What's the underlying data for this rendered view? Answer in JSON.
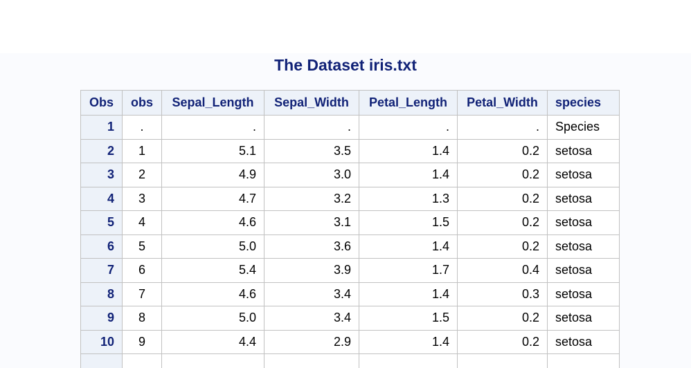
{
  "title": "The Dataset iris.txt",
  "table": {
    "headers": [
      "Obs",
      "obs",
      "Sepal_Length",
      "Sepal_Width",
      "Petal_Length",
      "Petal_Width",
      "species"
    ],
    "rows": [
      [
        "1",
        ".",
        ".",
        ".",
        ".",
        ".",
        "Species"
      ],
      [
        "2",
        "1",
        "5.1",
        "3.5",
        "1.4",
        "0.2",
        "setosa"
      ],
      [
        "3",
        "2",
        "4.9",
        "3.0",
        "1.4",
        "0.2",
        "setosa"
      ],
      [
        "4",
        "3",
        "4.7",
        "3.2",
        "1.3",
        "0.2",
        "setosa"
      ],
      [
        "5",
        "4",
        "4.6",
        "3.1",
        "1.5",
        "0.2",
        "setosa"
      ],
      [
        "6",
        "5",
        "5.0",
        "3.6",
        "1.4",
        "0.2",
        "setosa"
      ],
      [
        "7",
        "6",
        "5.4",
        "3.9",
        "1.7",
        "0.4",
        "setosa"
      ],
      [
        "8",
        "7",
        "4.6",
        "3.4",
        "1.4",
        "0.3",
        "setosa"
      ],
      [
        "9",
        "8",
        "5.0",
        "3.4",
        "1.5",
        "0.2",
        "setosa"
      ],
      [
        "10",
        "9",
        "4.4",
        "2.9",
        "1.4",
        "0.2",
        "setosa"
      ]
    ]
  },
  "colors": {
    "header_text": "#112277",
    "header_bg": "#edf2f9",
    "border": "#c1c1c1",
    "page_bg": "#fafbfe"
  }
}
